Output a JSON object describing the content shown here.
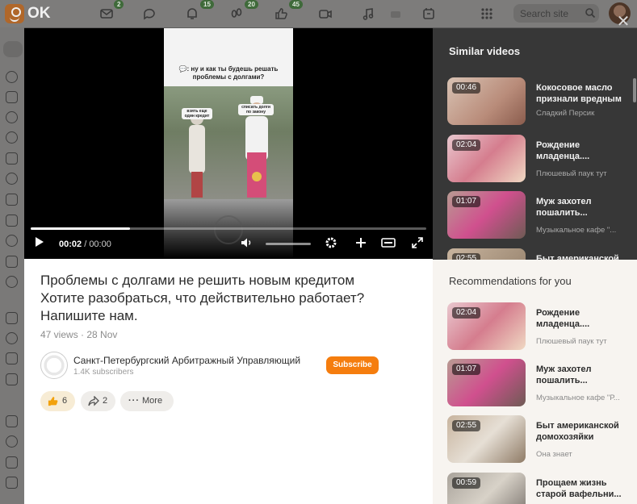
{
  "topbar": {
    "logo_text": "OK",
    "badges": [
      "2",
      "15",
      "20",
      "45"
    ],
    "search_placeholder": "Search site"
  },
  "player": {
    "caption": "💬: ну и как ты будешь решать проблемы с долгами?",
    "label_left": "взять еще один кредит",
    "label_right": "списать долги по закону",
    "time_current": "00:02",
    "time_total": "00:00",
    "progress_fraction": 0.25
  },
  "video": {
    "title": "Проблемы с долгами не решить новым кредитом Хотите разобраться, что действительно работает? Напишите нам.",
    "views_date": "47 views · 28 Nov",
    "channel_name": "Санкт-Петербургский Арбитражный Управляющий",
    "channel_subs": "1.4K subscribers",
    "subscribe_label": "Subscribe",
    "likes": "6",
    "shares": "2",
    "more_label": "More"
  },
  "similar": {
    "title": "Similar videos",
    "items": [
      {
        "duration": "00:46",
        "title": "Кокосовое масло признали вредным",
        "channel": "Сладкий Персик"
      },
      {
        "duration": "02:04",
        "title": "Рождение младенца....",
        "channel": "Плюшевый паук тут"
      },
      {
        "duration": "01:07",
        "title": "Муж захотел пошалить...",
        "channel": "Музыкальное кафе \"..."
      },
      {
        "duration": "02:55",
        "title": "Быт американской",
        "channel": ""
      }
    ]
  },
  "recommendations": {
    "title": "Recommendations for you",
    "items": [
      {
        "duration": "02:04",
        "title": "Рождение младенца....",
        "channel": "Плюшевый паук тут"
      },
      {
        "duration": "01:07",
        "title": "Муж захотел пошалить...",
        "channel": "Музыкальное кафе \"Р..."
      },
      {
        "duration": "02:55",
        "title": "Быт американской домохозяйки",
        "channel": "Она знает"
      },
      {
        "duration": "00:59",
        "title": "Прощаем жизнь старой вафельни...",
        "channel": ""
      }
    ]
  },
  "colors": {
    "accent": "#f57d0e",
    "panel_dark": "#373737",
    "panel_light": "#f7f4f0"
  }
}
